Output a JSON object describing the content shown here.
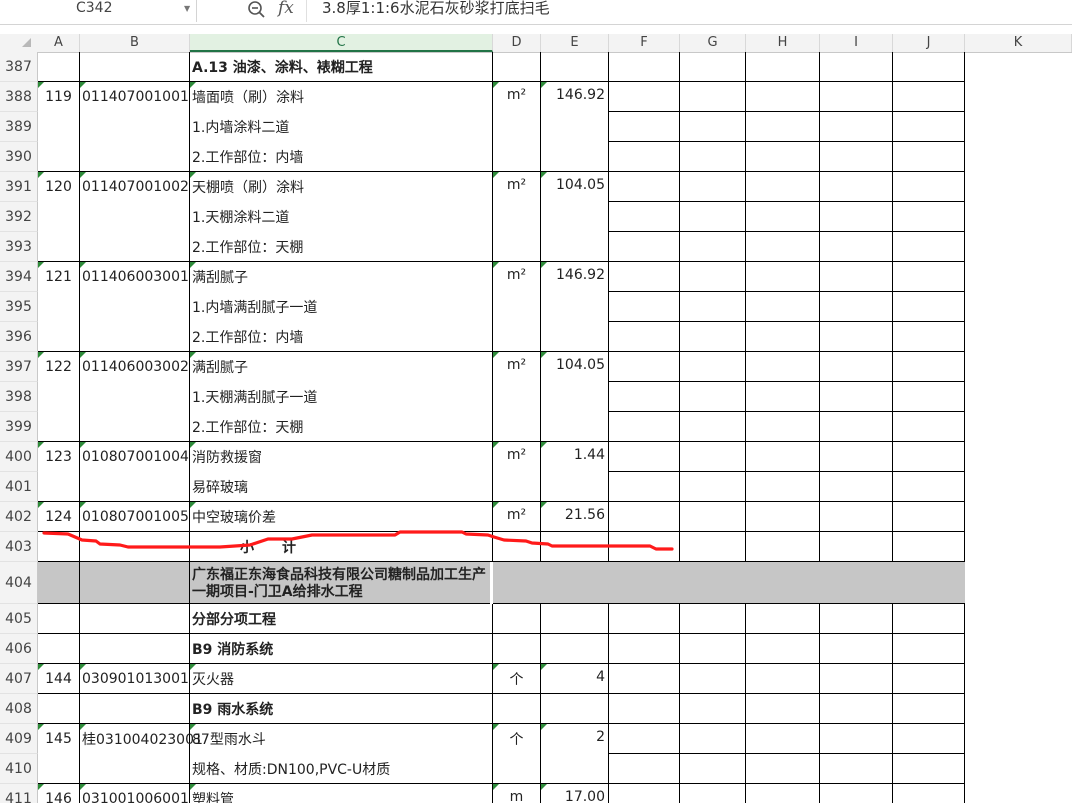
{
  "formula_bar": {
    "name_box": "C342",
    "fx_label": "fx",
    "formula": "3.8厚1:1:6水泥石灰砂浆打底扫毛"
  },
  "columns": [
    "A",
    "B",
    "C",
    "D",
    "E",
    "F",
    "G",
    "H",
    "I",
    "J",
    "K"
  ],
  "selected_column": "C",
  "rows": [
    {
      "num": "387",
      "a": "",
      "b": "",
      "c": "A.13 油漆、涂料、裱糊工程",
      "d": "",
      "e": "",
      "bold": true
    },
    {
      "num": "388",
      "a": "119",
      "b": "011407001001",
      "c": "墙面喷（刷）涂料",
      "d": "m²",
      "e": "146.92"
    },
    {
      "num": "389",
      "a": "",
      "b": "",
      "c": "1.内墙涂料二道",
      "d": "",
      "e": ""
    },
    {
      "num": "390",
      "a": "",
      "b": "",
      "c": "2.工作部位：内墙",
      "d": "",
      "e": ""
    },
    {
      "num": "391",
      "a": "120",
      "b": "011407001002",
      "c": "天棚喷（刷）涂料",
      "d": "m²",
      "e": "104.05"
    },
    {
      "num": "392",
      "a": "",
      "b": "",
      "c": "1.天棚涂料二道",
      "d": "",
      "e": ""
    },
    {
      "num": "393",
      "a": "",
      "b": "",
      "c": "2.工作部位：天棚",
      "d": "",
      "e": ""
    },
    {
      "num": "394",
      "a": "121",
      "b": "011406003001",
      "c": "满刮腻子",
      "d": "m²",
      "e": "146.92"
    },
    {
      "num": "395",
      "a": "",
      "b": "",
      "c": "1.内墙满刮腻子一道",
      "d": "",
      "e": ""
    },
    {
      "num": "396",
      "a": "",
      "b": "",
      "c": "2.工作部位：内墙",
      "d": "",
      "e": ""
    },
    {
      "num": "397",
      "a": "122",
      "b": "011406003002",
      "c": "满刮腻子",
      "d": "m²",
      "e": "104.05"
    },
    {
      "num": "398",
      "a": "",
      "b": "",
      "c": "1.天棚满刮腻子一道",
      "d": "",
      "e": ""
    },
    {
      "num": "399",
      "a": "",
      "b": "",
      "c": "2.工作部位：天棚",
      "d": "",
      "e": ""
    },
    {
      "num": "400",
      "a": "123",
      "b": "010807001004",
      "c": "消防救援窗",
      "d": "m²",
      "e": "1.44"
    },
    {
      "num": "401",
      "a": "",
      "b": "",
      "c": "易碎玻璃",
      "d": "",
      "e": ""
    },
    {
      "num": "402",
      "a": "124",
      "b": "010807001005",
      "c": "中空玻璃价差",
      "d": "m²",
      "e": "21.56"
    },
    {
      "num": "403",
      "a": "",
      "b": "",
      "c": "小　　计",
      "d": "",
      "e": "",
      "bold": true
    },
    {
      "num": "404",
      "a": "",
      "b": "",
      "c": "广东福正东海食品科技有限公司糖制品加工生产一期项目-门卫A给排水工程",
      "d": "",
      "e": "",
      "bold": true
    },
    {
      "num": "405",
      "a": "",
      "b": "",
      "c": "分部分项工程",
      "d": "",
      "e": "",
      "bold": true
    },
    {
      "num": "406",
      "a": "",
      "b": "",
      "c": "B9 消防系统",
      "d": "",
      "e": "",
      "bold": true
    },
    {
      "num": "407",
      "a": "144",
      "b": "030901013001",
      "c": "灭火器",
      "d": "个",
      "e": "4"
    },
    {
      "num": "408",
      "a": "",
      "b": "",
      "c": "B9 雨水系统",
      "d": "",
      "e": "",
      "bold": true
    },
    {
      "num": "409",
      "a": "145",
      "b": "桂031004023001",
      "c": "87型雨水斗",
      "d": "个",
      "e": "2"
    },
    {
      "num": "410",
      "a": "",
      "b": "",
      "c": "规格、材质:DN100,PVC-U材质",
      "d": "",
      "e": ""
    },
    {
      "num": "411",
      "a": "146",
      "b": "031001006001",
      "c": "塑料管",
      "d": "m",
      "e": "17.00"
    }
  ]
}
